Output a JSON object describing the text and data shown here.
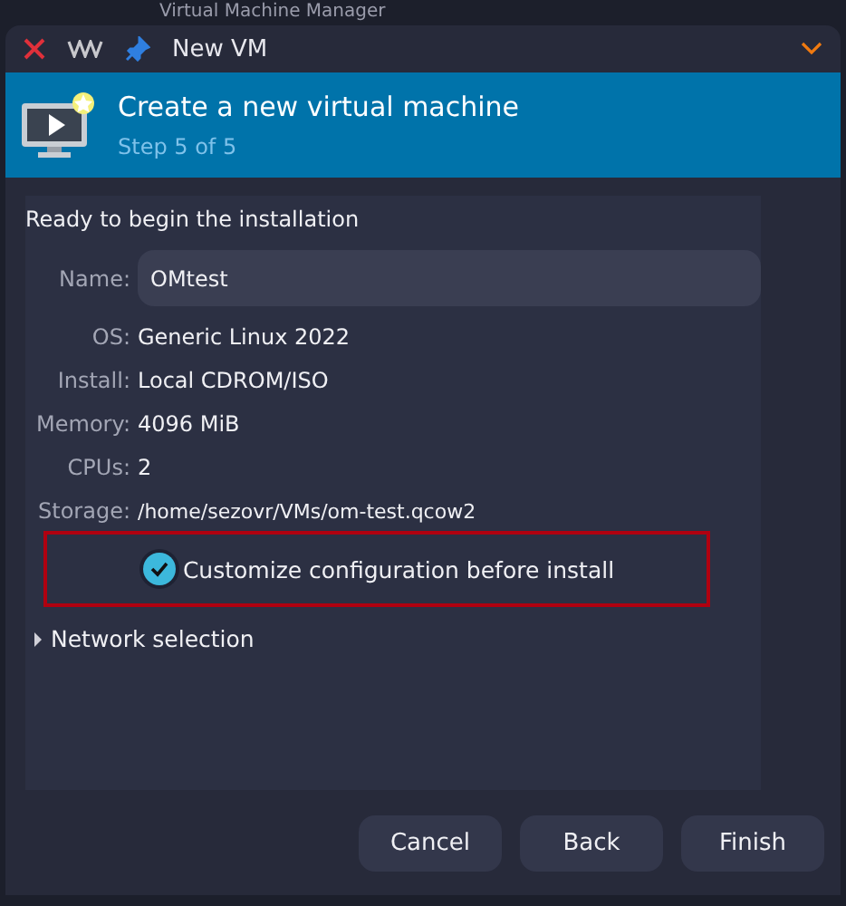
{
  "background_window": {
    "title": "Virtual Machine Manager"
  },
  "window": {
    "title": "New VM"
  },
  "banner": {
    "title": "Create a new virtual machine",
    "subtitle": "Step 5 of 5"
  },
  "heading": "Ready to begin the installation",
  "name_field": {
    "label": "Name:",
    "value": "OMtest"
  },
  "details": [
    {
      "label": "OS:",
      "value": "Generic Linux 2022"
    },
    {
      "label": "Install:",
      "value": "Local CDROM/ISO"
    },
    {
      "label": "Memory:",
      "value": "4096 MiB"
    },
    {
      "label": "CPUs:",
      "value": "2"
    },
    {
      "label": "Storage:",
      "value": "/home/sezovr/VMs/om-test.qcow2"
    }
  ],
  "customize": {
    "label": "Customize configuration before install",
    "checked": true,
    "highlighted": true
  },
  "network": {
    "label": "Network selection",
    "expanded": false
  },
  "buttons": [
    "Cancel",
    "Back",
    "Finish"
  ]
}
